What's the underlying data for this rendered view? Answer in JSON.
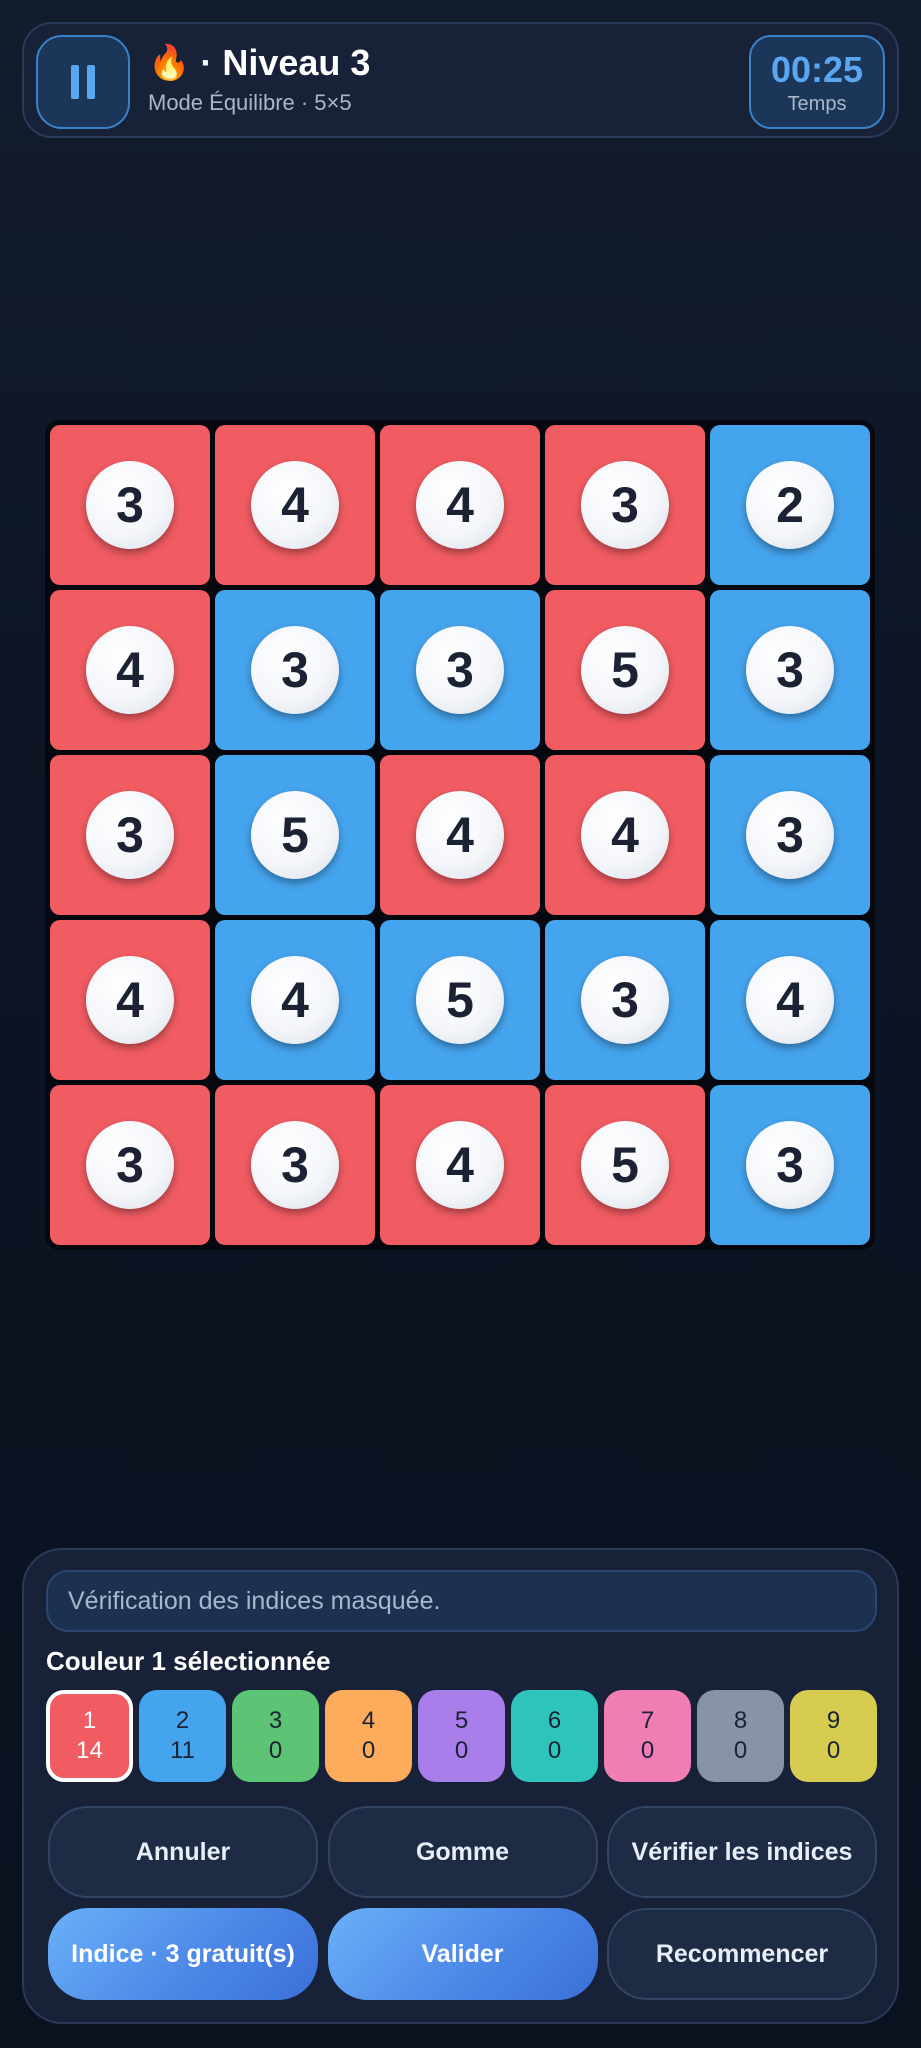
{
  "header": {
    "icon": "flame-icon",
    "title": "Niveau 3",
    "title_prefix": "· ",
    "subtitle": "Mode Équilibre · 5×5",
    "timer_value": "00:25",
    "timer_label": "Temps"
  },
  "colors": {
    "red": "#f05c62",
    "blue": "#45a4ee",
    "accent": "#5aa6f0",
    "background": "#0c1422"
  },
  "grid": {
    "rows": [
      [
        {
          "v": "3",
          "c": "red"
        },
        {
          "v": "4",
          "c": "red"
        },
        {
          "v": "4",
          "c": "red"
        },
        {
          "v": "3",
          "c": "red"
        },
        {
          "v": "2",
          "c": "blue"
        }
      ],
      [
        {
          "v": "4",
          "c": "red"
        },
        {
          "v": "3",
          "c": "blue"
        },
        {
          "v": "3",
          "c": "blue"
        },
        {
          "v": "5",
          "c": "red"
        },
        {
          "v": "3",
          "c": "blue"
        }
      ],
      [
        {
          "v": "3",
          "c": "red"
        },
        {
          "v": "5",
          "c": "blue"
        },
        {
          "v": "4",
          "c": "red"
        },
        {
          "v": "4",
          "c": "red"
        },
        {
          "v": "3",
          "c": "blue"
        }
      ],
      [
        {
          "v": "4",
          "c": "red"
        },
        {
          "v": "4",
          "c": "blue"
        },
        {
          "v": "5",
          "c": "blue"
        },
        {
          "v": "3",
          "c": "blue"
        },
        {
          "v": "4",
          "c": "blue"
        }
      ],
      [
        {
          "v": "3",
          "c": "red"
        },
        {
          "v": "3",
          "c": "red"
        },
        {
          "v": "4",
          "c": "red"
        },
        {
          "v": "5",
          "c": "red"
        },
        {
          "v": "3",
          "c": "blue"
        }
      ]
    ]
  },
  "panel": {
    "notice": "Vérification des indices masquée.",
    "selected_label": "Couleur 1 sélectionnée",
    "swatches": [
      {
        "num": "1",
        "count": "14",
        "color": "#f05c62",
        "selected": true
      },
      {
        "num": "2",
        "count": "11",
        "color": "#45a4ee",
        "selected": false
      },
      {
        "num": "3",
        "count": "0",
        "color": "#5cc474",
        "selected": false
      },
      {
        "num": "4",
        "count": "0",
        "color": "#fcac5a",
        "selected": false
      },
      {
        "num": "5",
        "count": "0",
        "color": "#a97eea",
        "selected": false
      },
      {
        "num": "6",
        "count": "0",
        "color": "#2ec4bc",
        "selected": false
      },
      {
        "num": "7",
        "count": "0",
        "color": "#f07eb4",
        "selected": false
      },
      {
        "num": "8",
        "count": "0",
        "color": "#8794a8",
        "selected": false
      },
      {
        "num": "9",
        "count": "0",
        "color": "#d6cc50",
        "selected": false
      }
    ],
    "buttons": {
      "undo": "Annuler",
      "eraser": "Gomme",
      "check": "Vérifier les indices",
      "hint": "Indice · 3 gratuit(s)",
      "validate": "Valider",
      "restart": "Recommencer"
    }
  }
}
